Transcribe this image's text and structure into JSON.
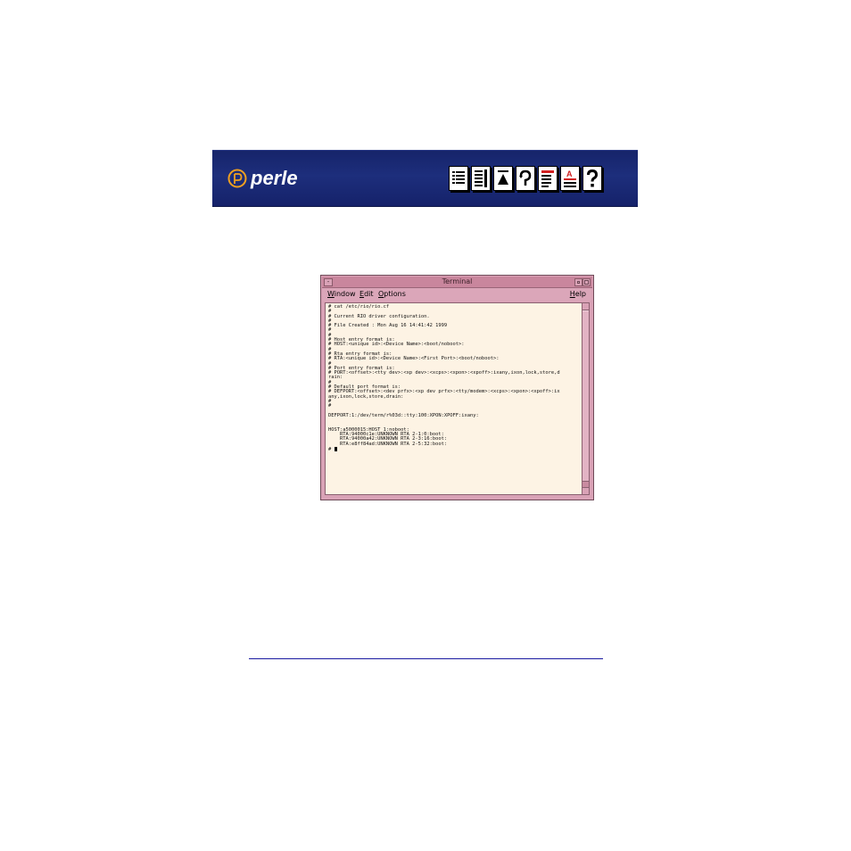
{
  "brand": {
    "logo_text": "perle",
    "logo_icon": "perle-logo-icon",
    "banner_color": "#1a2a72"
  },
  "nav_icons": [
    {
      "name": "contents-icon"
    },
    {
      "name": "index-icon"
    },
    {
      "name": "top-icon"
    },
    {
      "name": "back-icon"
    },
    {
      "name": "previous-page-icon"
    },
    {
      "name": "next-page-icon"
    },
    {
      "name": "help-icon"
    }
  ],
  "terminal": {
    "title": "Terminal",
    "menus": {
      "window": "Window",
      "edit": "Edit",
      "options": "Options",
      "help": "Help"
    },
    "lines": [
      "# cat /etc/rio/rio.cf",
      "#",
      "# Current RIO driver configuration.",
      "#",
      "# File Created : Mon Aug 16 14:41:42 1999",
      "#",
      "#",
      "# Host entry format is:",
      "# HOST:<unique id>:<Device Name>:<boot/noboot>:",
      "#",
      "# Rta entry format is:",
      "# RTA:<unique id>:<Device Name>:<First Port>:<boot/noboot>:",
      "#",
      "# Port entry format is:",
      "# PORT:<offset>:<tty dev>:<xp dev>:<xcps>:<xpon>:<xpoff>:ixany,ixon,lock,store,d",
      "rain:",
      "#",
      "# Default port format is:",
      "# DEFPORT:<offset>:<dev prfx>:<xp dev prfx>:<tty/modem>:<xcps>:<xpon>:<xpoff>:ix",
      "any,ixon,lock,store,drain:",
      "#",
      "#",
      "",
      "DEFPORT:1:/dev/term/r%03d::tty:100:XPON:XPOFF:ixany:",
      "",
      "",
      "HOST:a5000015:HOST 1:noboot:",
      "    RTA:94000c1e:UNKNOWN RTA 2-1:0:boot:",
      "    RTA:94000a42:UNKNOWN RTA 2-3:16:boot:",
      "    RTA:e8ff84ad:UNKNOWN RTA 2-5:32:boot:",
      "# "
    ],
    "colors": {
      "frame": "#d9a2b6",
      "background": "#fdf3e4"
    }
  }
}
